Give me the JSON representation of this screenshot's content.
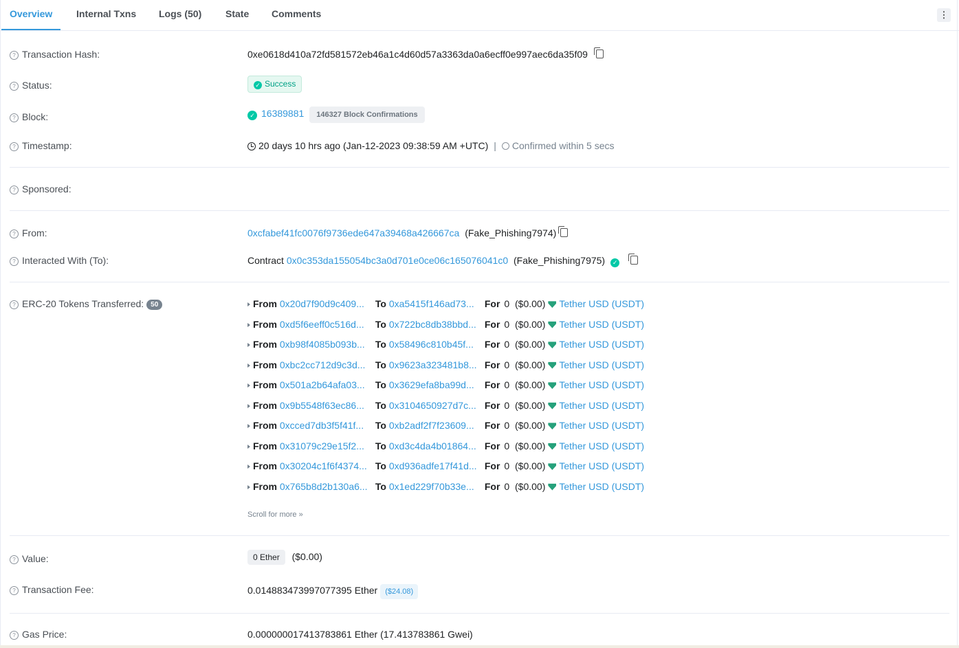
{
  "tabs": [
    {
      "label": "Overview",
      "active": true
    },
    {
      "label": "Internal Txns",
      "active": false
    },
    {
      "label": "Logs (50)",
      "active": false
    },
    {
      "label": "State",
      "active": false
    },
    {
      "label": "Comments",
      "active": false
    }
  ],
  "overview": {
    "tx_hash": {
      "label": "Transaction Hash:",
      "value": "0xe0618d410a72fd581572eb46a1c4d60d57a3363da0a6ecff0e997aec6da35f09"
    },
    "status": {
      "label": "Status:",
      "value": "Success"
    },
    "block": {
      "label": "Block:",
      "number": "16389881",
      "confirmations": "146327 Block Confirmations"
    },
    "timestamp": {
      "label": "Timestamp:",
      "value": "20 days 10 hrs ago (Jan-12-2023 09:38:59 AM +UTC)",
      "divider": "|",
      "confirmed": "Confirmed within 5 secs"
    },
    "sponsored": {
      "label": "Sponsored:"
    },
    "from": {
      "label": "From:",
      "address": "0xcfabef41fc0076f9736ede647a39468a426667ca",
      "tag": "(Fake_Phishing7974)"
    },
    "to": {
      "label": "Interacted With (To):",
      "prefix": "Contract",
      "address": "0x0c353da155054bc3a0d701e0ce06c165076041c0",
      "tag": "(Fake_Phishing7975)"
    },
    "tokens": {
      "label": "ERC-20 Tokens Transferred:",
      "count": "50",
      "from_label": "From",
      "to_label": "To",
      "for_label": "For",
      "scroll_more": "Scroll for more",
      "transfers": [
        {
          "from": "0x20d7f90d9c409...",
          "to": "0xa5415f146ad73...",
          "amount": "0",
          "usd": "($0.00)",
          "token": "Tether USD (USDT)"
        },
        {
          "from": "0xd5f6eeff0c516d...",
          "to": "0x722bc8db38bbd...",
          "amount": "0",
          "usd": "($0.00)",
          "token": "Tether USD (USDT)"
        },
        {
          "from": "0xb98f4085b093b...",
          "to": "0x58496c810b45f...",
          "amount": "0",
          "usd": "($0.00)",
          "token": "Tether USD (USDT)"
        },
        {
          "from": "0xbc2cc712d9c3d...",
          "to": "0x9623a323481b8...",
          "amount": "0",
          "usd": "($0.00)",
          "token": "Tether USD (USDT)"
        },
        {
          "from": "0x501a2b64afa03...",
          "to": "0x3629efa8ba99d...",
          "amount": "0",
          "usd": "($0.00)",
          "token": "Tether USD (USDT)"
        },
        {
          "from": "0x9b5548f63ec86...",
          "to": "0x3104650927d7c...",
          "amount": "0",
          "usd": "($0.00)",
          "token": "Tether USD (USDT)"
        },
        {
          "from": "0xcced7db3f5f41f...",
          "to": "0xb2adf2f7f23609...",
          "amount": "0",
          "usd": "($0.00)",
          "token": "Tether USD (USDT)"
        },
        {
          "from": "0x31079c29e15f2...",
          "to": "0xd3c4da4b01864...",
          "amount": "0",
          "usd": "($0.00)",
          "token": "Tether USD (USDT)"
        },
        {
          "from": "0x30204c1f6f4374...",
          "to": "0xd936adfe17f41d...",
          "amount": "0",
          "usd": "($0.00)",
          "token": "Tether USD (USDT)"
        },
        {
          "from": "0x765b8d2b130a6...",
          "to": "0x1ed229f70b33e...",
          "amount": "0",
          "usd": "($0.00)",
          "token": "Tether USD (USDT)"
        }
      ]
    },
    "value": {
      "label": "Value:",
      "amount": "0 Ether",
      "usd": "($0.00)"
    },
    "fee": {
      "label": "Transaction Fee:",
      "amount": "0.014883473997077395 Ether",
      "usd": "($24.08)"
    },
    "gas_price": {
      "label": "Gas Price:",
      "value": "0.000000017413783861 Ether (17.413783861 Gwei)"
    }
  },
  "colors": {
    "accent": "#3498db",
    "success": "#00c9a7",
    "tether": "#26a17b"
  }
}
